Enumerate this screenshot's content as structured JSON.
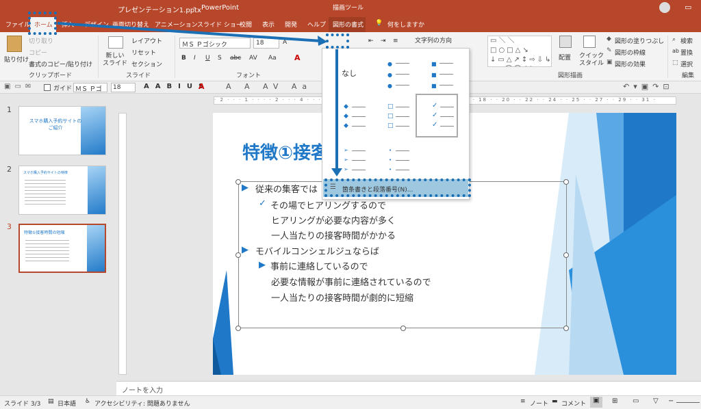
{
  "titlebar": {
    "document": "プレゼンテーション1.pptx",
    "app": "PowerPoint",
    "context_tab": "描画ツール"
  },
  "tabs": [
    "ファイル",
    "ホーム",
    "挿入",
    "デザイン",
    "画面切り替え",
    "アニメーション",
    "スライド ショー",
    "校閲",
    "表示",
    "開発",
    "ヘルプ",
    "図形の書式"
  ],
  "tell_me": "何をしますか",
  "ribbon": {
    "clipboard": {
      "paste": "貼り付け",
      "cut": "切り取り",
      "copy": "コピー",
      "format_painter": "書式のコピー/貼り付け",
      "group": "クリップボード"
    },
    "slides": {
      "new_slide": "新しい\nスライド",
      "layout": "レイアウト",
      "reset": "リセット",
      "section": "セクション",
      "group": "スライド"
    },
    "font": {
      "name": "ＭＳ Ｐゴシック",
      "size": "18",
      "group": "フォント"
    },
    "paragraph": {
      "text_direction": "文字列の方向"
    },
    "drawing": {
      "arrange": "配置",
      "quick_style": "クイック\nスタイル",
      "fill": "図形の塗りつぶし",
      "outline": "図形の枠線",
      "effect": "図形の効果",
      "group": "図形描画"
    },
    "editing": {
      "find": "検索",
      "replace": "置換",
      "select": "選択",
      "group": "編集"
    }
  },
  "qat": {
    "guide": "ガイド",
    "font": "ＭＳ Ｐゴ",
    "size": "18"
  },
  "dropdown": {
    "none": "なし",
    "bottom_link": "箇条書きと段落番号(N)..."
  },
  "thumbnails": [
    {
      "num": "1",
      "title": "スマホ購入予約サイトの\nご紹介"
    },
    {
      "num": "2",
      "title": "スマホ購入予約サイトの特徴"
    },
    {
      "num": "3",
      "title": "特徴①接客時間の短縮"
    }
  ],
  "slide": {
    "title": "特徴①接客",
    "lines": [
      "従来の集客では",
      "その場でヒアリングするので",
      "ヒアリングが必要な内容が多く",
      "一人当たりの接客時間がかかる",
      "モバイルコンシェルジュならば",
      "事前に連絡しているので",
      "必要な情報が事前に連絡されているので",
      "一人当たりの接客時間が劇的に短縮"
    ]
  },
  "notes": "ノートを入力",
  "status": {
    "slide": "スライド 3/3",
    "lang": "日本語",
    "accessibility": "アクセシビリティ: 問題ありません",
    "notes": "ノート",
    "comments": "コメント"
  },
  "colors": {
    "accent": "#b7472a",
    "highlight": "#1b6fb5",
    "slide_blue": "#1f78c8"
  }
}
